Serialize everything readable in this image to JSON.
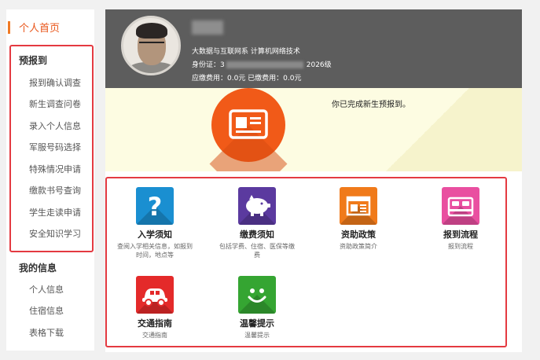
{
  "sidebar": {
    "home": "个人首页",
    "groups": [
      {
        "title": "预报到",
        "items": [
          "报到确认调查",
          "新生调查问卷",
          "录入个人信息",
          "军服号码选择",
          "特殊情况申请",
          "缴款书号查询",
          "学生走读申请",
          "安全知识学习"
        ]
      },
      {
        "title": "我的信息",
        "items": [
          "个人信息",
          "住宿信息",
          "表格下载"
        ]
      }
    ]
  },
  "profile": {
    "department": "大数据与互联网系 计算机网络技术",
    "id_label": "身份证：",
    "id_prefix": "3",
    "grade": "2026级",
    "fees": "应缴费用：0.0元 已缴费用：0.0元"
  },
  "status": {
    "message": "你已完成新生预报到。"
  },
  "tiles": [
    {
      "title": "入学须知",
      "desc": "查阅入学相关信息，如报到时间，地点等",
      "color": "#1a8fd1",
      "icon": "question-icon"
    },
    {
      "title": "缴费须知",
      "desc": "包括学费、住宿、医保等缴费",
      "color": "#5b3a9f",
      "icon": "piggy-bank-icon"
    },
    {
      "title": "资助政策",
      "desc": "资助政策简介",
      "color": "#f07a1a",
      "icon": "newspaper-icon"
    },
    {
      "title": "报到流程",
      "desc": "报到流程",
      "color": "#e94fa0",
      "icon": "bed-icon"
    },
    {
      "title": "交通指南",
      "desc": "交通指南",
      "color": "#e42a2a",
      "icon": "car-icon"
    },
    {
      "title": "温馨提示",
      "desc": "温馨提示",
      "color": "#35a532",
      "icon": "smile-icon"
    }
  ],
  "colors": {
    "accent": "#e9561b",
    "highlight_border": "#e43a41",
    "banner": "#5d5d5d",
    "status_bg": "#fdfce2",
    "badge": "#f15a18"
  }
}
